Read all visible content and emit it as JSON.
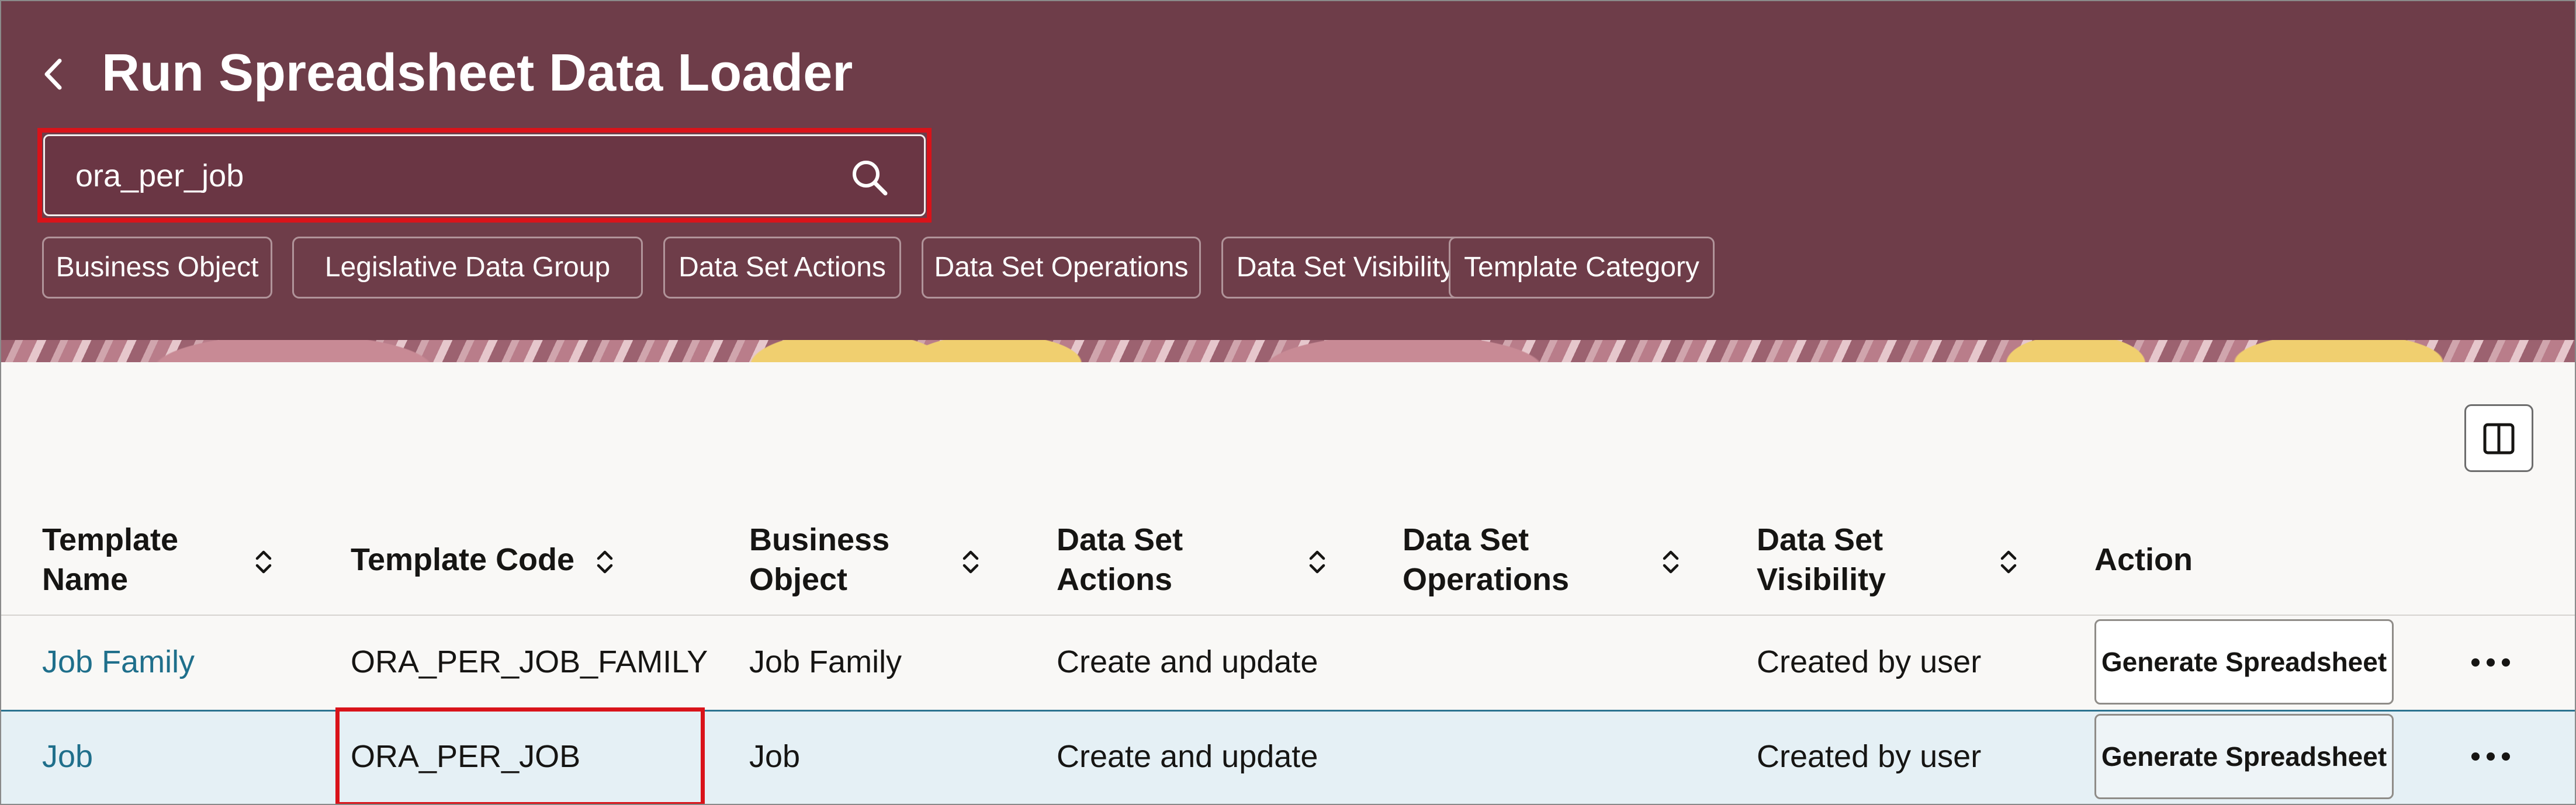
{
  "header": {
    "title": "Run Spreadsheet Data Loader",
    "back_icon": "chevron-left-icon",
    "search": {
      "value": "ora_per_job",
      "icon": "search-icon"
    },
    "filters": [
      "Business Object",
      "Legislative Data Group",
      "Data Set Actions",
      "Data Set Operations",
      "Data Set Visibility",
      "Template Category"
    ]
  },
  "toolbar": {
    "split_view_icon": "split-view-icon"
  },
  "table": {
    "columns": [
      {
        "line1": "Template",
        "line2": "Name",
        "sortable": true
      },
      {
        "line1": "Template Code",
        "line2": "",
        "sortable": true
      },
      {
        "line1": "Business",
        "line2": "Object",
        "sortable": true
      },
      {
        "line1": "Data Set",
        "line2": "Actions",
        "sortable": true
      },
      {
        "line1": "Data Set",
        "line2": "Operations",
        "sortable": true
      },
      {
        "line1": "Data Set",
        "line2": "Visibility",
        "sortable": true
      },
      {
        "line1": "Action",
        "line2": "",
        "sortable": false
      }
    ],
    "rows": [
      {
        "template_name": "Job Family",
        "template_code": "ORA_PER_JOB_FAMILY",
        "business_object": "Job Family",
        "data_set_actions": "Create and update",
        "data_set_operations": "",
        "data_set_visibility": "Created by user",
        "action_label": "Generate Spreadsheet",
        "selected": false
      },
      {
        "template_name": "Job",
        "template_code": "ORA_PER_JOB",
        "business_object": "Job",
        "data_set_actions": "Create and update",
        "data_set_operations": "",
        "data_set_visibility": "Created by user",
        "action_label": "Generate Spreadsheet",
        "selected": true
      }
    ]
  },
  "colors": {
    "header_bg": "#6e3d49",
    "highlight_border": "#d9131a",
    "link": "#1f6f8b",
    "selected_row_bg": "#e5f0f5"
  }
}
